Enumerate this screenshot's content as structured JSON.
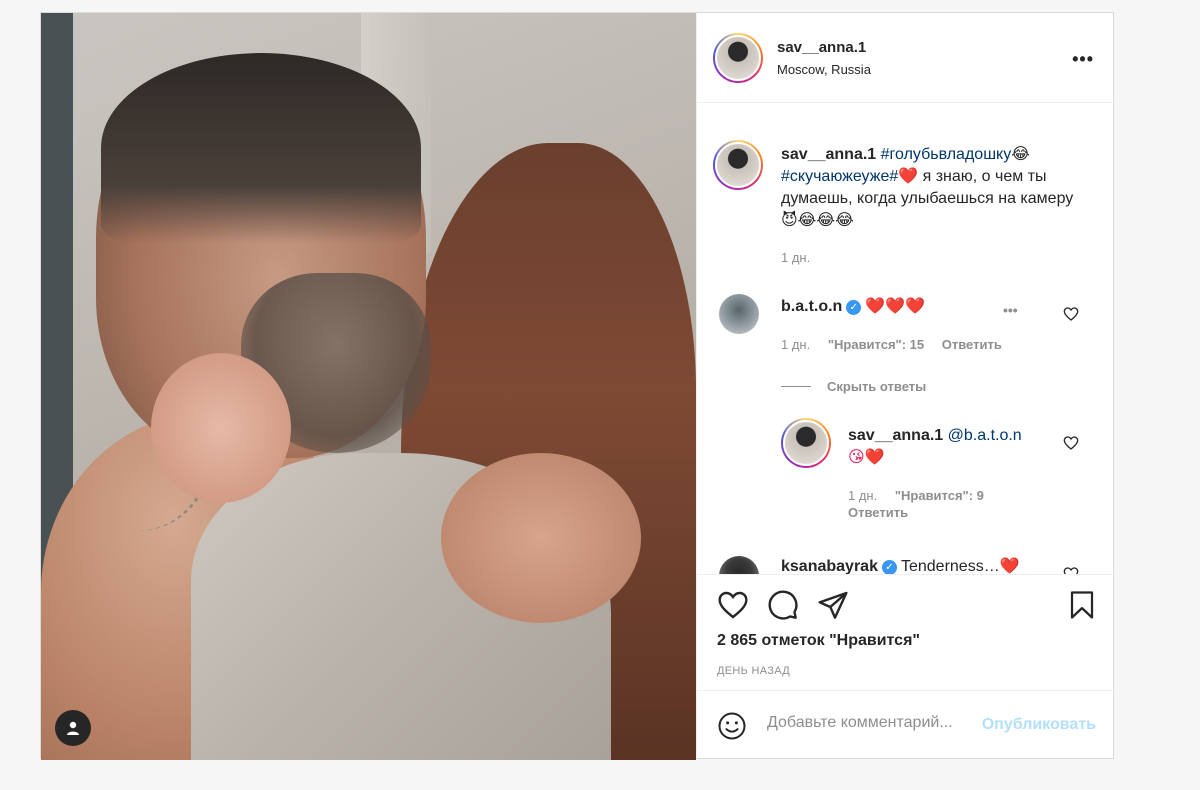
{
  "post": {
    "author": "sav__anna.1",
    "location": "Moscow, Russia",
    "more_label": "•••",
    "caption": {
      "user": "sav__anna.1",
      "tag1": "#голубьвладошку",
      "emoji1": "😂",
      "tag2": "#скучаюжеуже#",
      "emoji2": "❤️",
      "text": " я знаю, о чем ты думаешь, когда улыбаешься на камеру",
      "emoji3": "😈😂😂😂",
      "time": "1 дн."
    },
    "comments": [
      {
        "user": "b.a.t.o.n",
        "verified": true,
        "text": "❤️❤️❤️",
        "time": "1 дн.",
        "likes": "\"Нравится\": 15",
        "reply_label": "Ответить",
        "hide_replies_label": "Скрыть ответы",
        "more_label": "•••",
        "replies": [
          {
            "user": "sav__anna.1",
            "mention": "@b.a.t.o.n",
            "text": "😘❤️",
            "time": "1 дн.",
            "likes": "\"Нравится\": 9",
            "reply_label": "Ответить"
          }
        ]
      },
      {
        "user": "ksanabayrak",
        "verified": true,
        "text": "Tenderness…❤️"
      }
    ],
    "likes_count": "2 865 отметок \"Нравится\"",
    "time_ago": "ДЕНЬ НАЗАД",
    "comment_input": {
      "placeholder": "Добавьте комментарий...",
      "publish_label": "Опубликовать"
    }
  },
  "colors": {
    "text": "#262626",
    "secondary": "#8e8e8e",
    "link": "#00376b",
    "verified": "#3897f0",
    "heart": "#e0245e",
    "publish_disabled": "#b2dffc"
  }
}
